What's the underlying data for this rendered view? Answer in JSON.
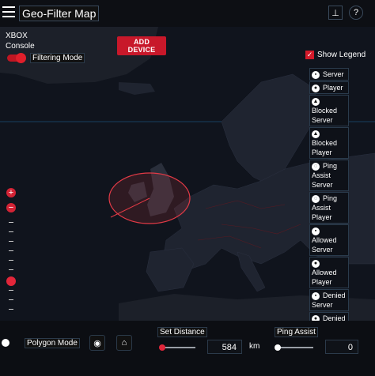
{
  "header": {
    "title": "Geo-Filter Map",
    "menu_icon": "hamburger-menu-icon",
    "pin_icon": "pin-icon",
    "help_icon": "help-icon",
    "pin_glyph": "⊥",
    "help_glyph": "?"
  },
  "device": {
    "name_line1": "XBOX",
    "name_line2": "Console",
    "filtering_mode_label": "Filtering Mode",
    "filtering_mode_on": true,
    "add_device_label": "ADD DEVICE"
  },
  "legend": {
    "show_label": "Show Legend",
    "checked": true,
    "items": [
      {
        "label": "Server",
        "icon": "server-icon",
        "glyph": "▪"
      },
      {
        "label": "Player",
        "icon": "player-icon",
        "glyph": "●"
      },
      {
        "label": "Blocked Server",
        "icon": "blocked-server-icon",
        "glyph": "▲"
      },
      {
        "label": "Blocked Player",
        "icon": "blocked-player-icon",
        "glyph": "▲"
      },
      {
        "label": "Ping Assist Server",
        "icon": "ping-assist-server-icon",
        "glyph": "◌"
      },
      {
        "label": "Ping Assist Player",
        "icon": "ping-assist-player-icon",
        "glyph": "◌"
      },
      {
        "label": "Allowed Server",
        "icon": "allowed-server-icon",
        "glyph": "▪"
      },
      {
        "label": "Allowed Player",
        "icon": "allowed-player-icon",
        "glyph": "●"
      },
      {
        "label": "Denied Server",
        "icon": "denied-server-icon",
        "glyph": "▪"
      },
      {
        "label": "Denied Player",
        "icon": "denied-player-icon",
        "glyph": "●"
      }
    ]
  },
  "zoom": {
    "plus_label": "+",
    "minus_label": "−",
    "level_fraction": 0.7
  },
  "bottom": {
    "polygon_mode_label": "Polygon Mode",
    "polygon_mode_on": false,
    "location_icon": "location-pin-icon",
    "home_icon": "home-icon",
    "location_glyph": "◉",
    "home_glyph": "⌂",
    "set_distance_label": "Set Distance",
    "distance_value": "584",
    "distance_unit": "km",
    "distance_fraction": 0.05,
    "ping_assist_label": "Ping Assist",
    "ping_value": "0",
    "ping_fraction": 0.0
  },
  "colors": {
    "accent": "#d31a2a",
    "map_water": "#0e1119",
    "map_land": "#1f2430",
    "filter_circle": "#e23a46"
  }
}
